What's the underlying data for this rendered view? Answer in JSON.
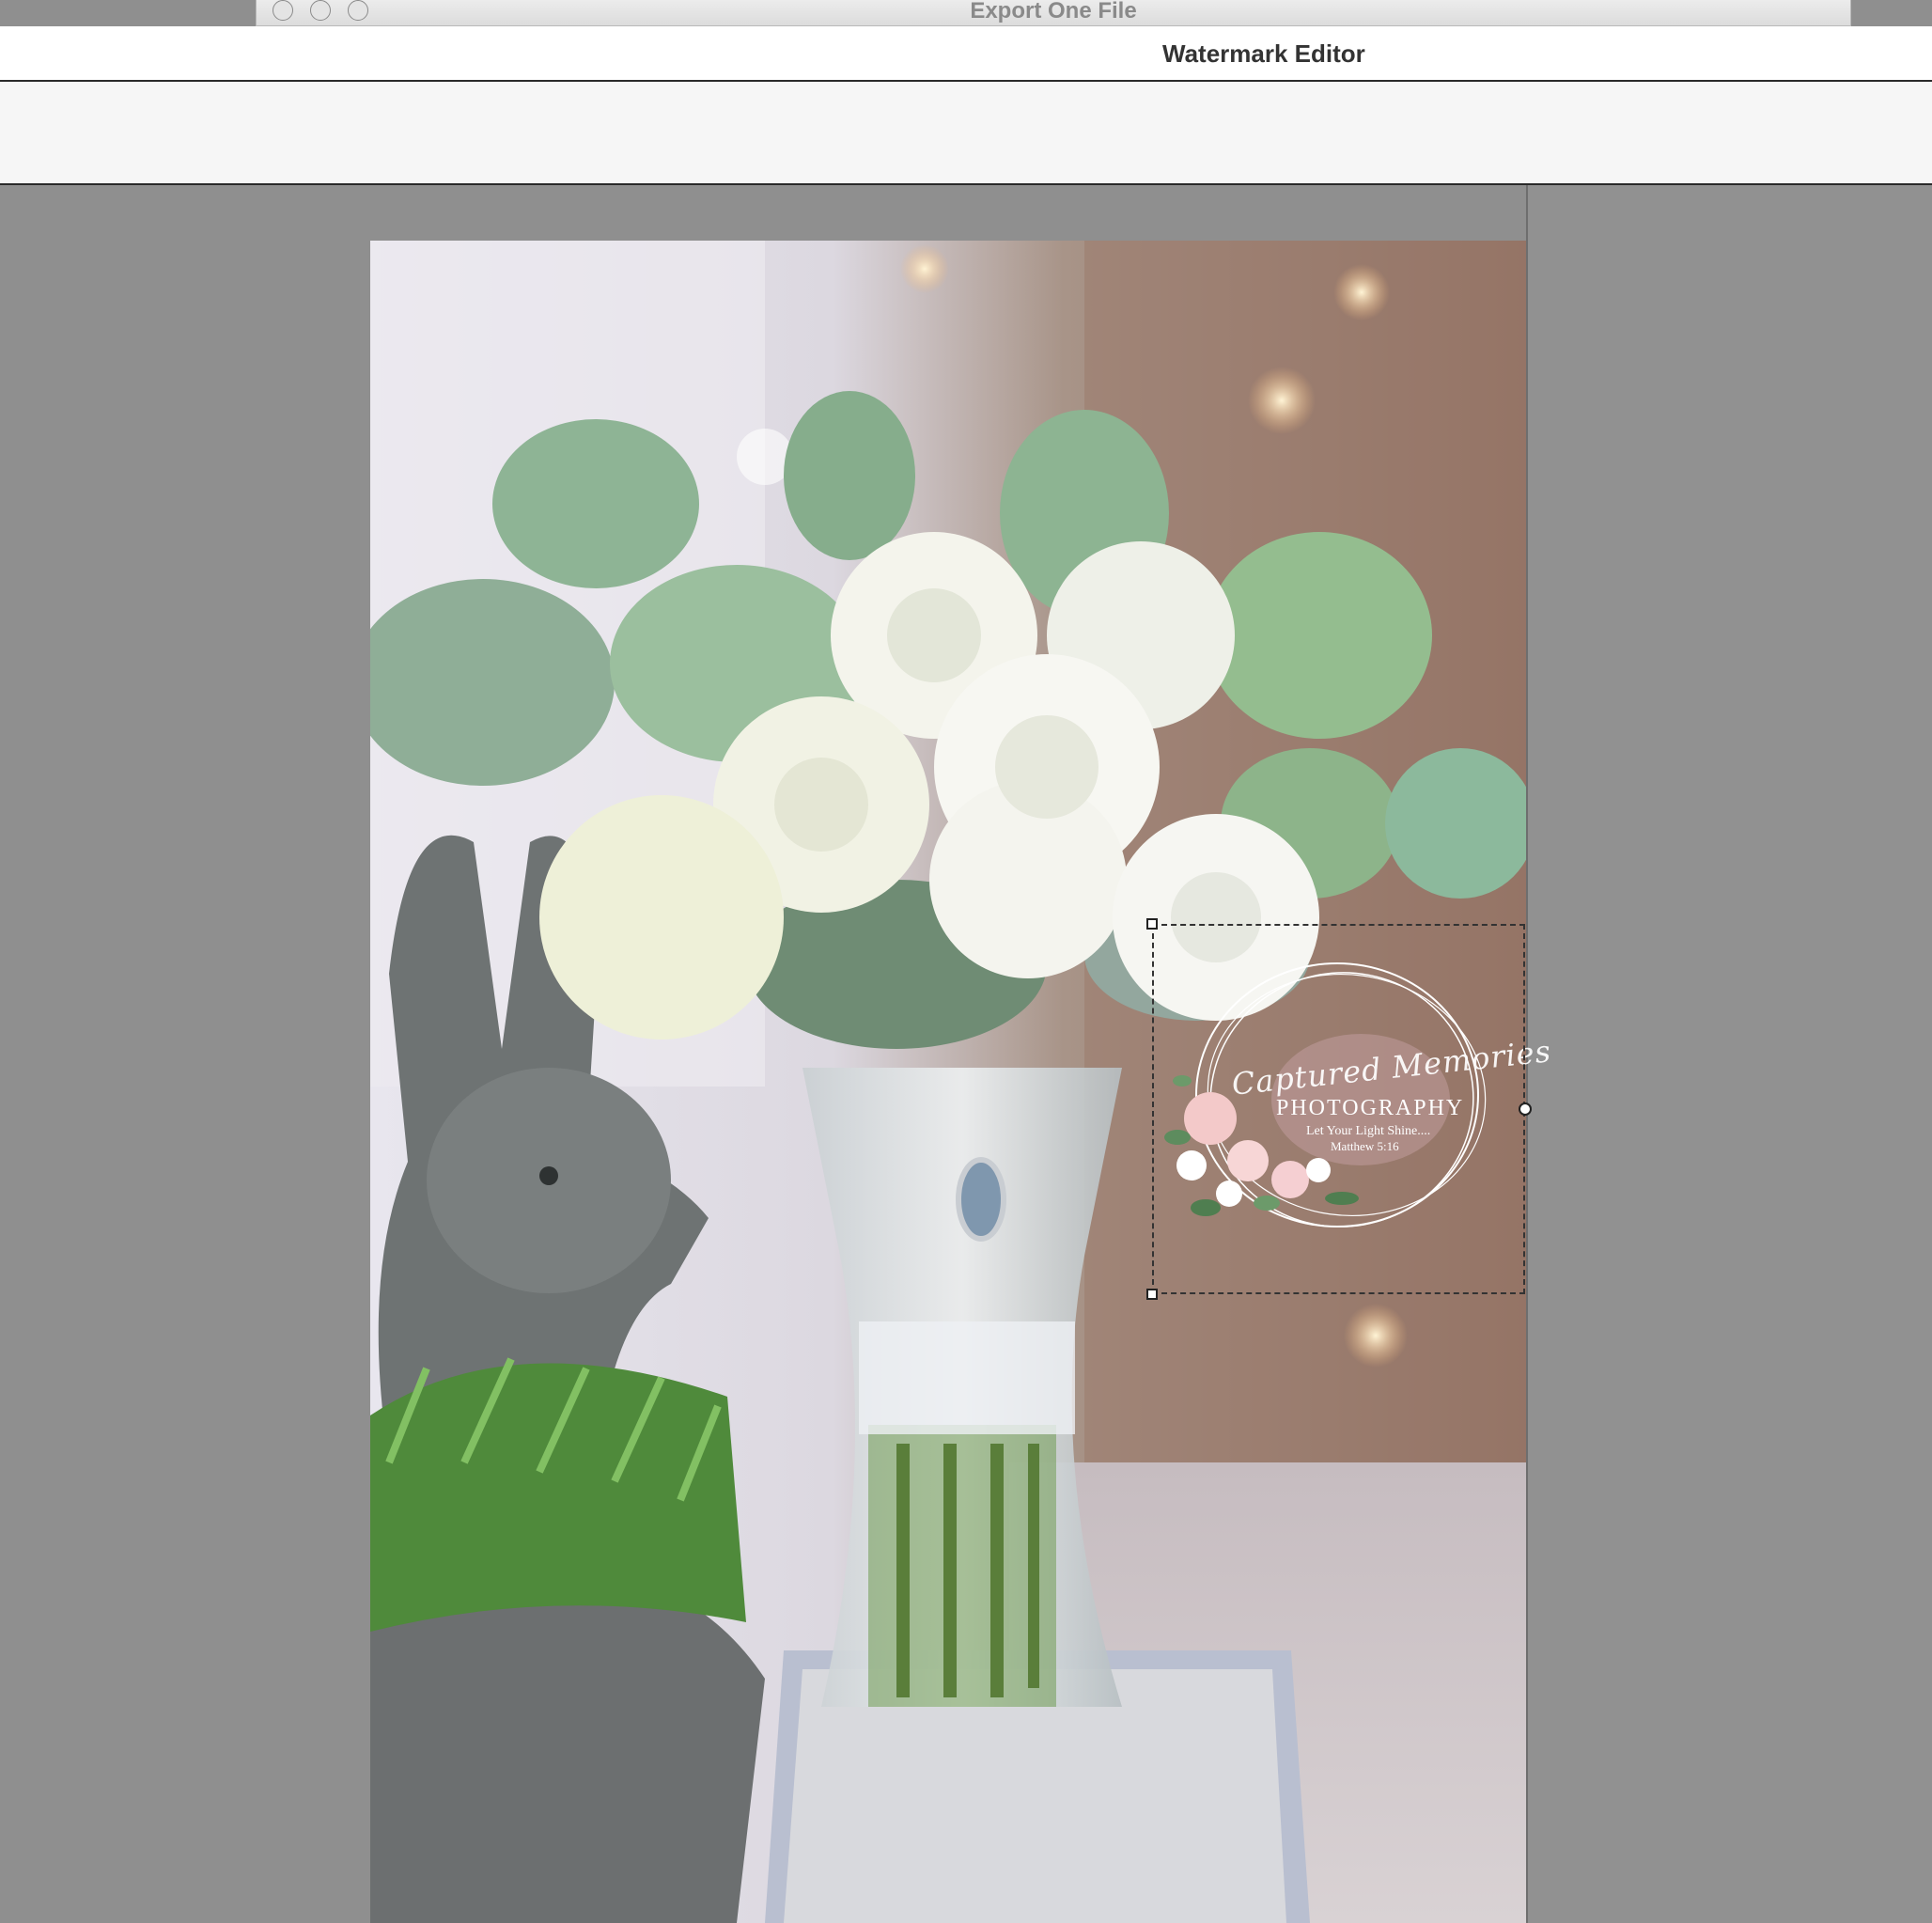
{
  "back_window": {
    "title": "Export One File"
  },
  "editor": {
    "title": "Watermark Editor"
  },
  "watermark": {
    "script_line": "Captured Memories",
    "main_line": "PHOTOGRAPHY",
    "tagline": "Let Your Light Shine....",
    "verse": "Matthew 5:16"
  },
  "colors": {
    "canvas_bg": "#8f8f8f",
    "toolbar_bg": "#f6f6f6",
    "selection_border": "#333333"
  }
}
